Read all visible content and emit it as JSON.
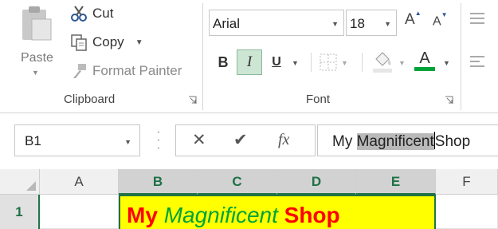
{
  "ribbon": {
    "clipboard": {
      "paste_label": "Paste",
      "cut_label": "Cut",
      "copy_label": "Copy",
      "format_painter_label": "Format Painter",
      "group_label": "Clipboard"
    },
    "font": {
      "font_name": "Arial",
      "font_size": "18",
      "bold_label": "B",
      "italic_label": "I",
      "underline_label": "U",
      "font_color_label": "A",
      "group_label": "Font",
      "font_color": "#00a33a",
      "italic_active": true
    }
  },
  "formula_bar": {
    "name_box": "B1",
    "formula_before": "My ",
    "formula_selected": "Magnificent",
    "formula_after": "Shop"
  },
  "grid": {
    "columns": [
      "A",
      "B",
      "C",
      "D",
      "E",
      "F"
    ],
    "selected_columns": [
      "B",
      "C",
      "D",
      "E"
    ],
    "rows": [
      "1"
    ],
    "merged_cell": {
      "range": "B1:E1",
      "word1": "My",
      "word2": "Magnificent",
      "word3": "Shop",
      "fill_color": "#ffff00"
    }
  }
}
